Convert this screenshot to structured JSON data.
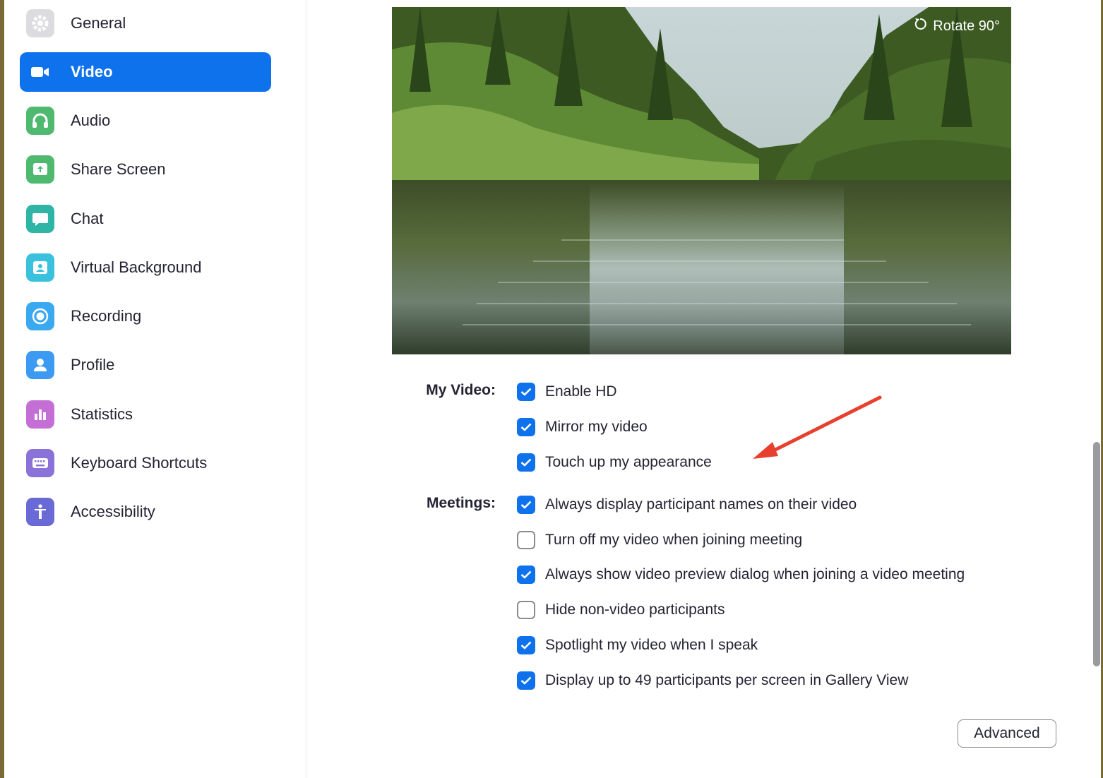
{
  "sidebar": {
    "items": [
      {
        "label": "General",
        "icon": "gear-icon",
        "color": "#d8d8dc",
        "active": false
      },
      {
        "label": "Video",
        "icon": "video-camera-icon",
        "color": "#0e72ed",
        "active": true
      },
      {
        "label": "Audio",
        "icon": "headphones-icon",
        "color": "#4fba6f",
        "active": false
      },
      {
        "label": "Share Screen",
        "icon": "share-screen-icon",
        "color": "#4fba6f",
        "active": false
      },
      {
        "label": "Chat",
        "icon": "chat-bubble-icon",
        "color": "#2fb5a5",
        "active": false
      },
      {
        "label": "Virtual Background",
        "icon": "virtual-background-icon",
        "color": "#39c1dd",
        "active": false
      },
      {
        "label": "Recording",
        "icon": "recording-icon",
        "color": "#3aa9f0",
        "active": false
      },
      {
        "label": "Profile",
        "icon": "profile-icon",
        "color": "#3d9af2",
        "active": false
      },
      {
        "label": "Statistics",
        "icon": "statistics-icon",
        "color": "#c46fd6",
        "active": false
      },
      {
        "label": "Keyboard Shortcuts",
        "icon": "keyboard-icon",
        "color": "#8a72d8",
        "active": false
      },
      {
        "label": "Accessibility",
        "icon": "accessibility-icon",
        "color": "#6a6ad6",
        "active": false
      }
    ]
  },
  "preview": {
    "rotate_label": "Rotate 90°"
  },
  "my_video": {
    "label": "My Video:",
    "options": [
      {
        "label": "Enable HD",
        "checked": true
      },
      {
        "label": "Mirror my video",
        "checked": true
      },
      {
        "label": "Touch up my appearance",
        "checked": true
      }
    ]
  },
  "meetings": {
    "label": "Meetings:",
    "options": [
      {
        "label": "Always display participant names on their video",
        "checked": true
      },
      {
        "label": "Turn off my video when joining meeting",
        "checked": false
      },
      {
        "label": "Always show video preview dialog when joining a video meeting",
        "checked": true
      },
      {
        "label": "Hide non-video participants",
        "checked": false
      },
      {
        "label": "Spotlight my video when I speak",
        "checked": true
      },
      {
        "label": "Display up to 49 participants per screen in Gallery View",
        "checked": true
      }
    ]
  },
  "advanced_label": "Advanced",
  "colors": {
    "accent": "#0e72ed",
    "annotation_arrow": "#e8402e"
  }
}
